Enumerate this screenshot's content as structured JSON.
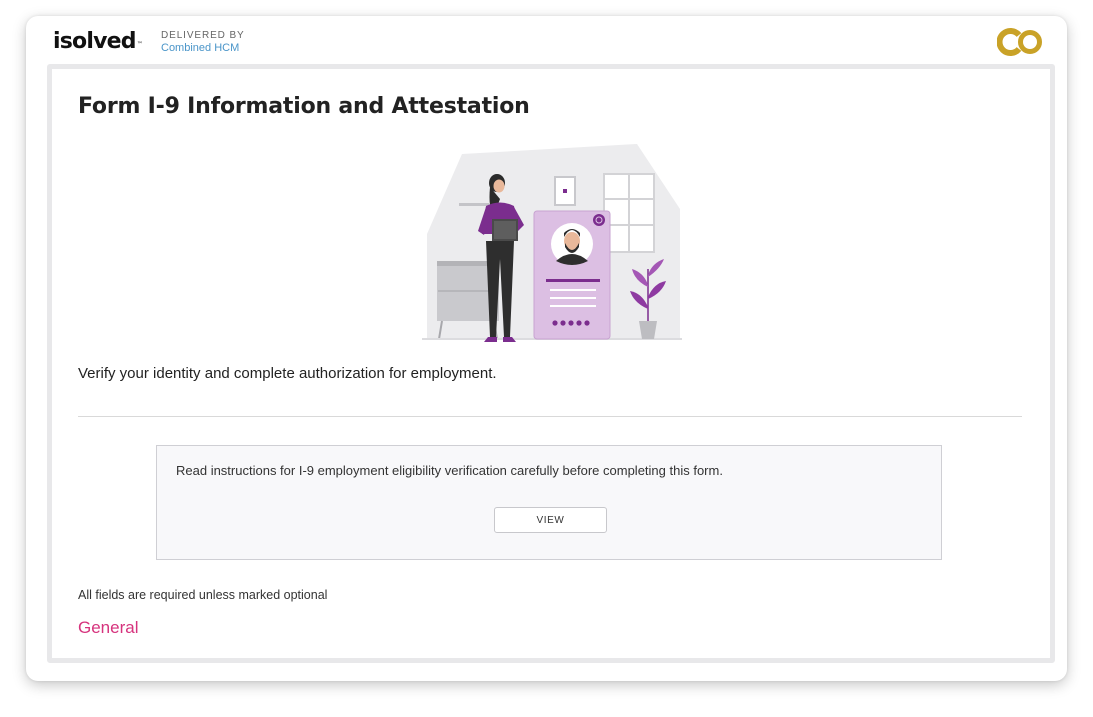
{
  "header": {
    "logo_text": "isolved",
    "trademark": "™",
    "delivered_by_label": "DELIVERED BY",
    "provider_name": "Combined HCM",
    "brand_logo_icon": "co-logo-icon"
  },
  "page": {
    "title": "Form I-9 Information and Attestation",
    "illustration_icon": "employee-id-card-illustration",
    "intro_text": "Verify your identity and complete authorization for employment.",
    "instructions": {
      "text": "Read instructions for I-9 employment eligibility verification carefully before completing this form.",
      "view_label": "VIEW"
    },
    "required_note": "All fields are required unless marked optional",
    "section_heading": "General"
  },
  "colors": {
    "accent_pink": "#d6337d",
    "brand_purple": "#7b2d8e",
    "gold": "#c9a227",
    "link_blue": "#4a95c9"
  }
}
